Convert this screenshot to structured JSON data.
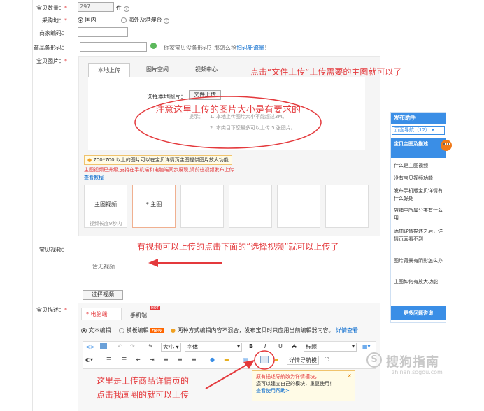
{
  "form": {
    "qty_label": "宝贝数量：",
    "qty_value": "297",
    "qty_unit": "件",
    "purchase_label": "采购地：",
    "purchase_opt1": "国内",
    "purchase_opt2": "海外及港澳台",
    "merchant_code_label": "商家编码：",
    "barcode_label": "商品条形码：",
    "barcode_hint": "你家宝贝没条形码？那怎么抢",
    "barcode_link": "扫码新流量",
    "barcode_hint_end": "！",
    "image_label": "宝贝图片：",
    "video_label": "宝贝视频：",
    "desc_label": "宝贝描述：",
    "required_mark": "*"
  },
  "image_tabs": [
    "本地上传",
    "图片空间",
    "视频中心"
  ],
  "upload": {
    "choose_label": "选择本地图片：",
    "file_button": "文件上传",
    "tip_label": "提示：",
    "tip1": "1. 本地上传图片大小不能超过3M。",
    "tip2": "2. 本类目下您最多可以上传 5 张图片。",
    "notice": "700*700 以上的图片可以在宝贝详情页主图提供图片放大功能",
    "video_notice": "主图视频已升级,支持在手机端和电脑端同步展现,请前往视频发布上传",
    "video_link": "查看教程",
    "slot_video": "主图视频",
    "slot_video_sub": "视频长度9秒内",
    "slot_main": "* 主图"
  },
  "video": {
    "none_text": "暂无视频",
    "select_button": "选择视频"
  },
  "desc": {
    "tab_pc": "* 电脑端",
    "tab_mobile": "手机端",
    "hot_badge": "HOT",
    "mode1": "文本编辑",
    "mode2": "模板编辑",
    "new_badge": "new",
    "mode_note": "两种方式编辑内容不混合，发布宝贝时只应用当前编辑器内容。",
    "mode_link": "详情查看"
  },
  "toolbar": {
    "size": "大小",
    "font": "字体",
    "bold": "B",
    "italic": "I",
    "underline": "U",
    "strike": "A",
    "heading": "标题",
    "nav": "详情导航模"
  },
  "popup": {
    "line1": "原有描述导航改为详情模块，",
    "line2": "您可以建立自己的模块，重复使用！",
    "line3": "查看使用帮助>"
  },
  "annotations": {
    "a1": "点击“文件上传”上传需要的主图就可以了",
    "a2": "注意这里上传的图片大小是有要求的",
    "a3": "有视频可以上传的点击下面的“选择视频”就可以上传了",
    "a4_line1": "这里是上传商品详情页的",
    "a4_line2": "点击我画圈的就可以上传"
  },
  "sidebar": {
    "title": "发布助手",
    "nav": "页面导航（12）",
    "section": "宝贝主图及描述",
    "items": [
      "什么是主图视频",
      "没有宝贝视频功能",
      "发布手机版宝贝详情有什么好处",
      "店铺中所属分类有什么用",
      "添加详情描述之后，详情页面看不到",
      "图片背景有阴影怎么办",
      "主图如何有放大功能"
    ],
    "more": "更多问题咨询"
  },
  "watermark": {
    "brand": "搜狗指南",
    "url": "zhinan.sogou.com"
  },
  "colors": {
    "annotation_red": "#e4393c",
    "sidebar_blue": "#3a8ee6",
    "link_blue": "#0066cc",
    "notice_bg": "#fffbe6"
  }
}
